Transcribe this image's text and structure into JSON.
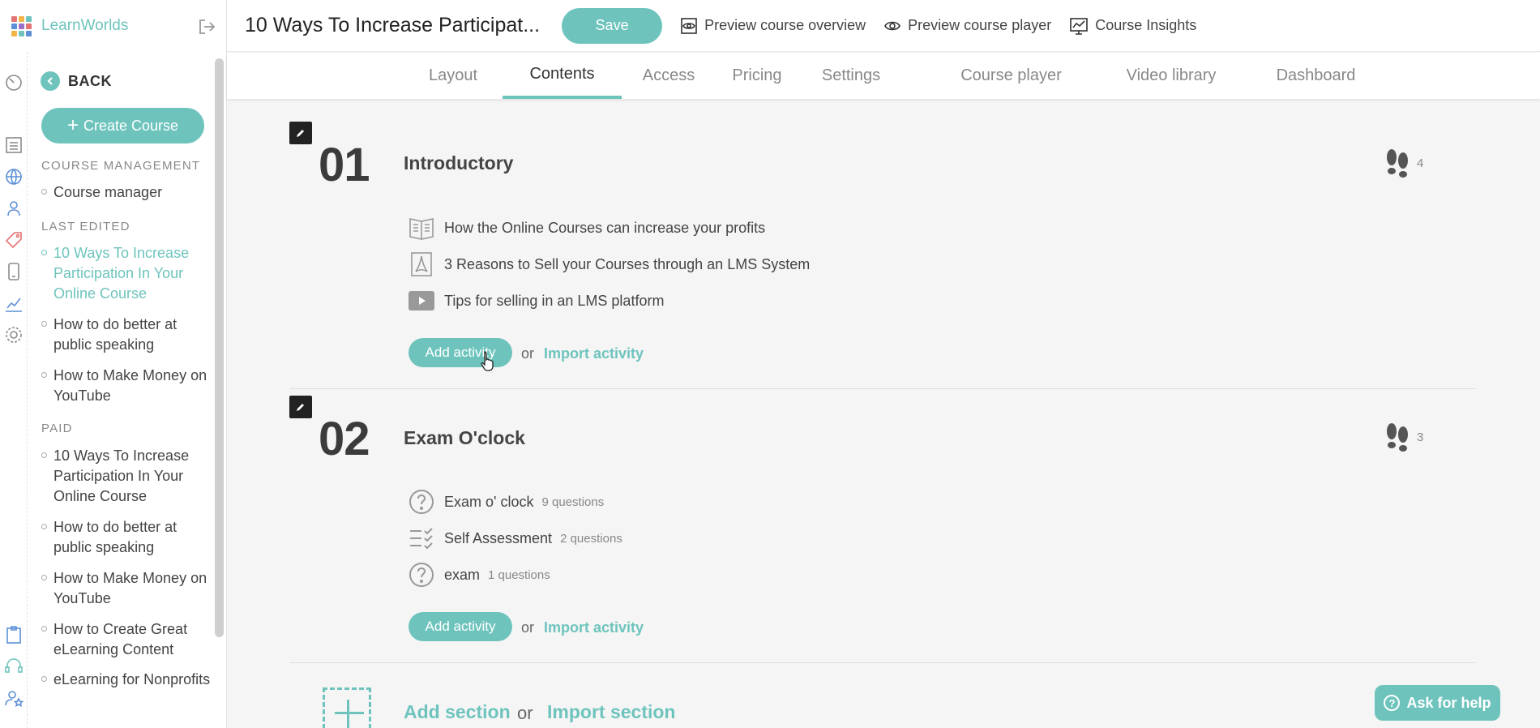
{
  "brand": {
    "name": "LearnWorlds",
    "accent": "#6ec4bd"
  },
  "header": {
    "course_title": "10 Ways To Increase Participat...",
    "save_label": "Save",
    "links": [
      {
        "label": "Preview course overview",
        "icon": "eye-icon"
      },
      {
        "label": "Preview course player",
        "icon": "eye-icon"
      },
      {
        "label": "Course Insights",
        "icon": "insights-chart-icon"
      }
    ]
  },
  "tabs": [
    {
      "label": "Layout",
      "active": false
    },
    {
      "label": "Contents",
      "active": true
    },
    {
      "label": "Access",
      "active": false
    },
    {
      "label": "Pricing",
      "active": false
    },
    {
      "label": "Settings",
      "active": false
    },
    {
      "label": "Course player",
      "active": false
    },
    {
      "label": "Video library",
      "active": false
    },
    {
      "label": "Dashboard",
      "active": false
    }
  ],
  "sidebar": {
    "back_label": "BACK",
    "create_label": "Create Course",
    "groups": [
      {
        "heading": "COURSE MANAGEMENT",
        "items": [
          "Course manager"
        ]
      },
      {
        "heading": "LAST EDITED",
        "items": [
          "10 Ways To Increase Participation In Your Online Course",
          "How to do better at public speaking",
          "How to Make Money on YouTube"
        ]
      },
      {
        "heading": "PAID",
        "items": [
          "10 Ways To Increase Participation In Your Online Course",
          "How to do better at public speaking",
          "How to Make Money on YouTube",
          "How to Create Great eLearning Content",
          "eLearning for Nonprofits"
        ]
      }
    ]
  },
  "sections": [
    {
      "number": "01",
      "title": "Introductory",
      "steps": "4",
      "activities": [
        {
          "name": "How the Online Courses can increase your profits",
          "meta": "",
          "icon": "ebook-icon"
        },
        {
          "name": "3 Reasons to Sell your Courses through an LMS System",
          "meta": "",
          "icon": "pdf-icon"
        },
        {
          "name": "Tips for selling in an LMS platform",
          "meta": "",
          "icon": "video-icon"
        }
      ],
      "add_activity": "Add activity",
      "or": "or",
      "import_activity": "Import activity"
    },
    {
      "number": "02",
      "title": "Exam O'clock",
      "steps": "3",
      "activities": [
        {
          "name": "Exam o' clock",
          "meta": "9 questions",
          "icon": "question-icon"
        },
        {
          "name": "Self Assessment",
          "meta": "2 questions",
          "icon": "checklist-icon"
        },
        {
          "name": "exam",
          "meta": "1 questions",
          "icon": "question-icon"
        }
      ],
      "add_activity": "Add activity",
      "or": "or",
      "import_activity": "Import activity"
    }
  ],
  "footer": {
    "add_section": "Add section",
    "or": "or",
    "import_section": "Import section",
    "help_label": "Ask for help"
  }
}
